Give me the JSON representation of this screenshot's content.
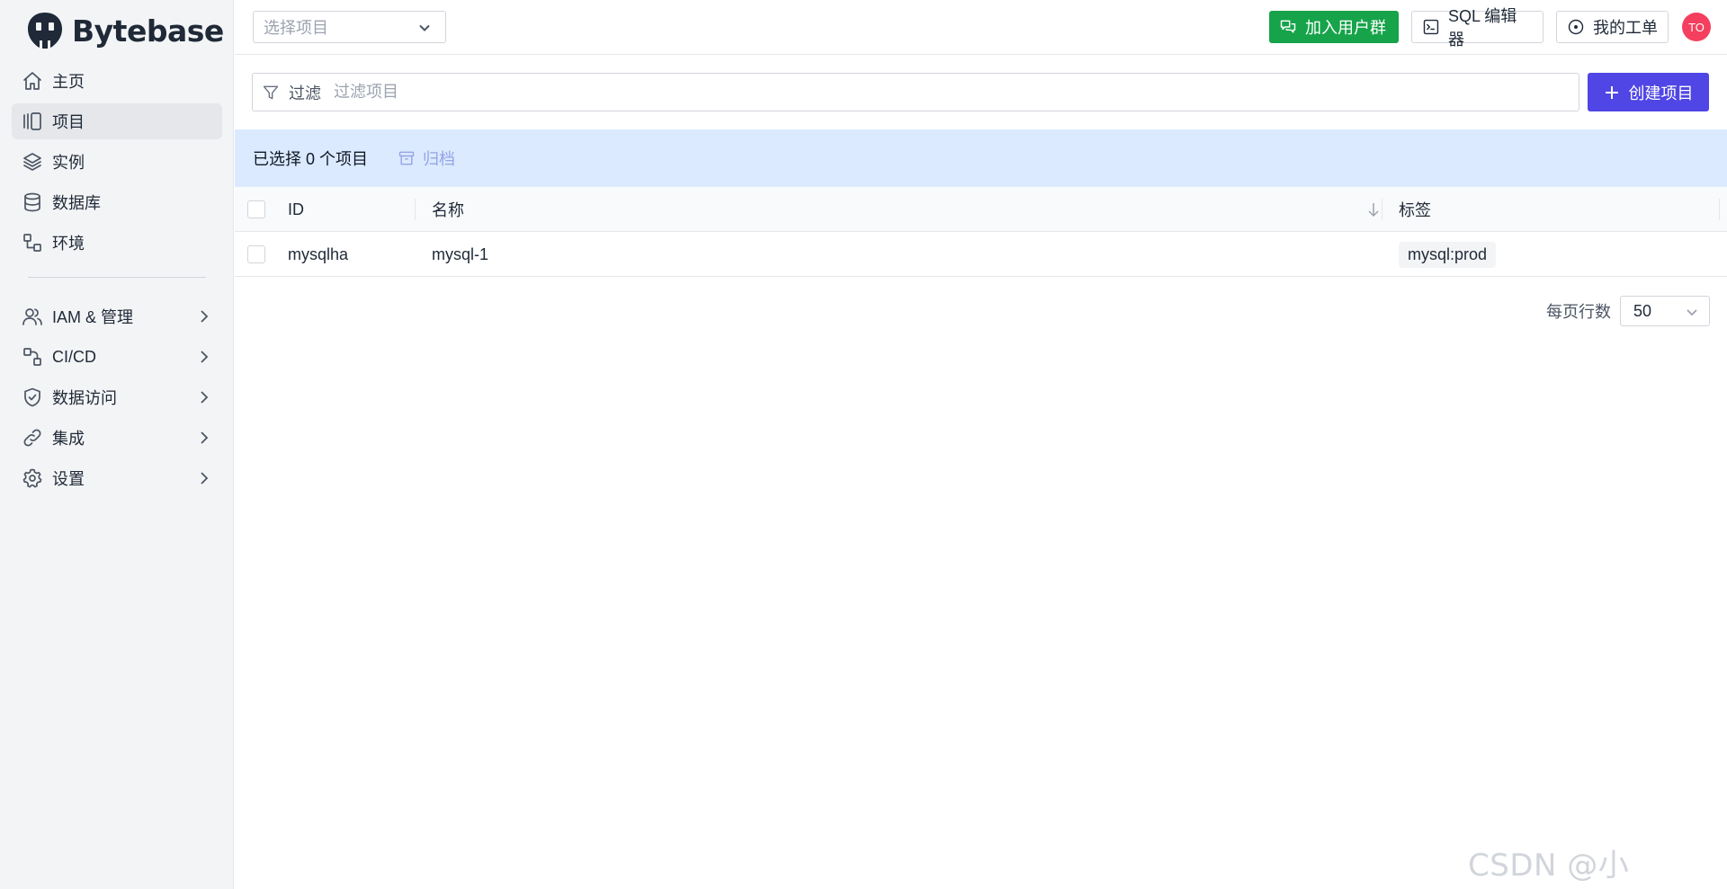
{
  "app": {
    "name": "Bytebase"
  },
  "sidebar": {
    "items": [
      {
        "label": "主页",
        "icon": "home-icon",
        "active": false
      },
      {
        "label": "项目",
        "icon": "project-icon",
        "active": true
      },
      {
        "label": "实例",
        "icon": "layers-icon",
        "active": false
      },
      {
        "label": "数据库",
        "icon": "database-icon",
        "active": false
      },
      {
        "label": "环境",
        "icon": "environment-icon",
        "active": false
      }
    ],
    "groups": [
      {
        "label": "IAM & 管理",
        "icon": "users-icon"
      },
      {
        "label": "CI/CD",
        "icon": "workflow-icon"
      },
      {
        "label": "数据访问",
        "icon": "shield-icon"
      },
      {
        "label": "集成",
        "icon": "link-icon"
      },
      {
        "label": "设置",
        "icon": "gear-icon"
      }
    ]
  },
  "header": {
    "project_select_placeholder": "选择项目",
    "join_group_label": "加入用户群",
    "sql_editor_label": "SQL 编辑器",
    "my_issues_label": "我的工单",
    "avatar_initials": "TO",
    "join_color": "#16a34a",
    "avatar_color": "#f43f5e"
  },
  "filter": {
    "label": "过滤",
    "placeholder": "过滤项目",
    "value": ""
  },
  "create_button_label": "创建项目",
  "create_button_color": "#4f46e5",
  "selection": {
    "text": "已选择 0 个项目",
    "archive_label": "归档"
  },
  "table": {
    "columns": [
      "ID",
      "名称",
      "标签"
    ],
    "rows": [
      {
        "id": "mysqlha",
        "name": "mysql-1",
        "labels": [
          "mysql:prod"
        ]
      }
    ]
  },
  "pagination": {
    "rows_per_page_label": "每页行数",
    "rows_per_page": "50"
  },
  "watermark": "CSDN @小Tomkk"
}
